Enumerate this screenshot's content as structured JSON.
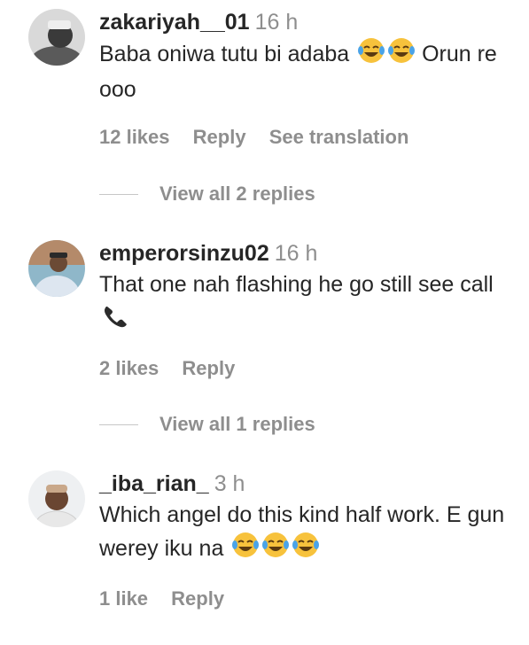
{
  "comments": [
    {
      "username": "zakariyah__01",
      "time": "16 h",
      "text": "Baba oniwa tutu bi adaba",
      "text_suffix": "Orun re ooo",
      "emoji_count": 2,
      "likes": "12 likes",
      "reply": "Reply",
      "translation": "See translation",
      "view_replies": "View all 2 replies"
    },
    {
      "username": "emperorsinzu02",
      "time": "16 h",
      "text": "That one nah flashing he go still see call",
      "likes": "2 likes",
      "reply": "Reply",
      "view_replies": "View all 1 replies"
    },
    {
      "username": "_iba_rian_",
      "time": "3 h",
      "text": "Which angel do this kind half work. E gun werey iku na",
      "emoji_count": 3,
      "likes": "1 like",
      "reply": "Reply"
    }
  ],
  "icons": {
    "laugh": "face-with-tears-of-joy-icon",
    "phone": "telephone-receiver-icon"
  }
}
